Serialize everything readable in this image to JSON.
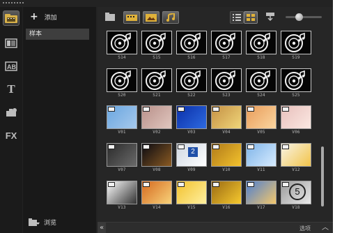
{
  "library": {
    "add_label": "添加",
    "items": [
      {
        "label": "样本"
      }
    ],
    "browse_label": "浏览"
  },
  "toolbar": {
    "filters": [
      "video-filter",
      "photo-filter",
      "audio-filter"
    ],
    "views": [
      "list-view",
      "thumbnail-view"
    ],
    "sort": "sort-icon",
    "zoom_level": 0.35
  },
  "media": {
    "audio": [
      [
        "S14",
        "S15",
        "S16",
        "S17",
        "S18",
        "S19"
      ],
      [
        "S20",
        "S21",
        "S22",
        "S23",
        "S24",
        "S25"
      ]
    ],
    "video": [
      [
        {
          "label": "V01",
          "colors": [
            "#6aa6e0",
            "#a6c9ec"
          ]
        },
        {
          "label": "V02",
          "colors": [
            "#b9908a",
            "#e0c7bf"
          ]
        },
        {
          "label": "V03",
          "colors": [
            "#0a2fa8",
            "#2e6ae0"
          ]
        },
        {
          "label": "V04",
          "colors": [
            "#c49044",
            "#f0d67a"
          ]
        },
        {
          "label": "V05",
          "colors": [
            "#e89c5a",
            "#fbd6a0"
          ]
        },
        {
          "label": "V06",
          "colors": [
            "#e8c0bc",
            "#fbe8e2"
          ]
        }
      ],
      [
        {
          "label": "V07",
          "colors": [
            "#2a2a2a",
            "#6a6a6a"
          ]
        },
        {
          "label": "V08",
          "colors": [
            "#0a0a12",
            "#8a5a22"
          ]
        },
        {
          "label": "V09",
          "colors": [
            "#cfd7e2",
            "#ffffff"
          ]
        },
        {
          "label": "V10",
          "colors": [
            "#b07a1a",
            "#f3c22d"
          ]
        },
        {
          "label": "V11",
          "colors": [
            "#7fb4e8",
            "#d8ecff"
          ]
        },
        {
          "label": "V12",
          "colors": [
            "#f8f4e6",
            "#f2c44a"
          ]
        }
      ],
      [
        {
          "label": "V13",
          "colors": [
            "#ffffff",
            "#333333"
          ]
        },
        {
          "label": "V14",
          "colors": [
            "#d56a20",
            "#f8d27a"
          ]
        },
        {
          "label": "V15",
          "colors": [
            "#f2c12e",
            "#fff0a0"
          ]
        },
        {
          "label": "V16",
          "colors": [
            "#9a6a14",
            "#f6c92e"
          ]
        },
        {
          "label": "V17",
          "colors": [
            "#4f7fcf",
            "#f3c76b"
          ]
        },
        {
          "label": "V18",
          "colors": [
            "#9b9b9b",
            "#e9e9e9"
          ]
        }
      ]
    ]
  },
  "v09_number": "2",
  "v18_number": "5",
  "bottom": {
    "collapse": "«",
    "options_label": "选项",
    "options_arrow": "︿"
  }
}
